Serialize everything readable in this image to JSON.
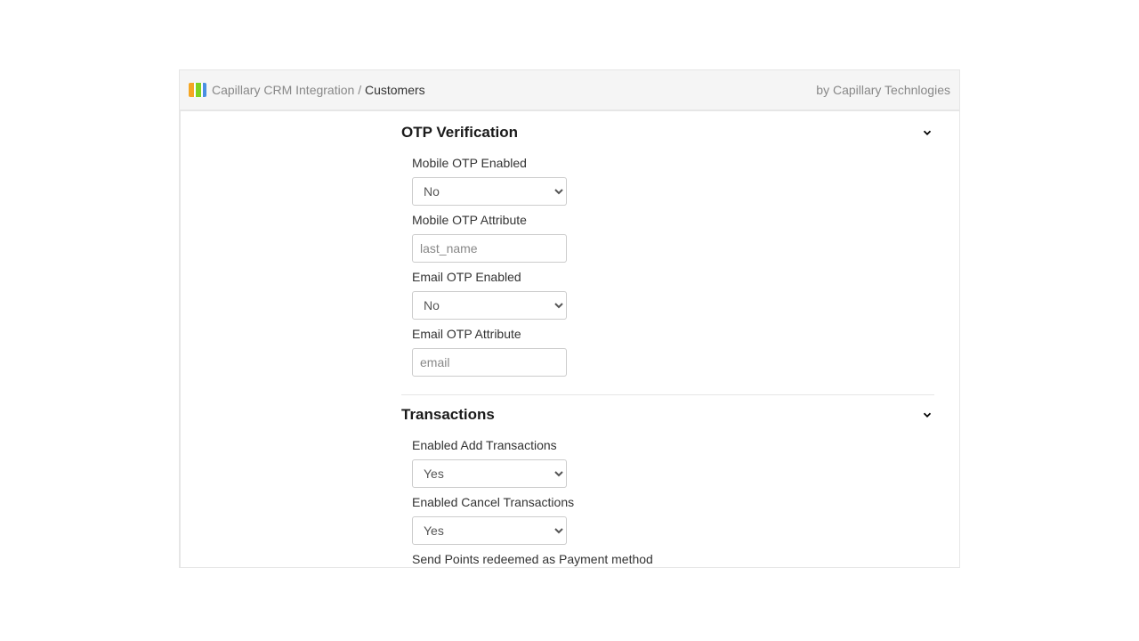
{
  "header": {
    "breadcrumb_root": "Capillary CRM Integration",
    "breadcrumb_sep": "/",
    "breadcrumb_current": "Customers",
    "vendor": "by Capillary Technlogies"
  },
  "sections": {
    "otp": {
      "title": "OTP Verification",
      "fields": {
        "mobile_otp_enabled": {
          "label": "Mobile OTP Enabled",
          "value": "No"
        },
        "mobile_otp_attribute": {
          "label": "Mobile OTP Attribute",
          "placeholder": "last_name",
          "value": ""
        },
        "email_otp_enabled": {
          "label": "Email OTP Enabled",
          "value": "No"
        },
        "email_otp_attribute": {
          "label": "Email OTP Attribute",
          "placeholder": "email",
          "value": ""
        }
      }
    },
    "transactions": {
      "title": "Transactions",
      "fields": {
        "enabled_add": {
          "label": "Enabled Add Transactions",
          "value": "Yes"
        },
        "enabled_cancel": {
          "label": "Enabled Cancel Transactions",
          "value": "Yes"
        },
        "send_points": {
          "label": "Send Points redeemed as Payment method"
        }
      }
    }
  },
  "select_options": {
    "yes": "Yes",
    "no": "No"
  }
}
